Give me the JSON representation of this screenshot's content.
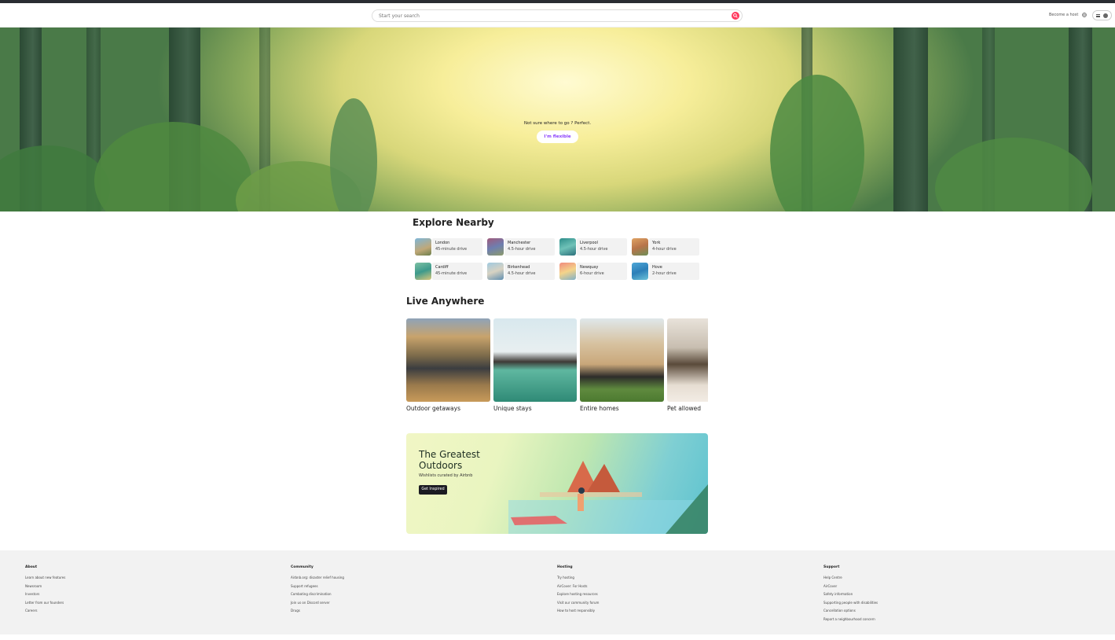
{
  "header": {
    "search_placeholder": "Start your search",
    "become_host": "Become a host"
  },
  "hero": {
    "tagline": "Not sure where to go ? Perfect.",
    "flexible_button": "I'm flexible"
  },
  "explore_nearby": {
    "title": "Explore Nearby",
    "items": [
      {
        "city": "London",
        "drive": "45-minute drive"
      },
      {
        "city": "Manchester",
        "drive": "4.5-hour drive"
      },
      {
        "city": "Liverpool",
        "drive": "4.5-hour drive"
      },
      {
        "city": "York",
        "drive": "4-hour drive"
      },
      {
        "city": "Cardiff",
        "drive": "45-minute drive"
      },
      {
        "city": "Birkenhead",
        "drive": "4.5-hour drive"
      },
      {
        "city": "Newquay",
        "drive": "6-hour drive"
      },
      {
        "city": "Hove",
        "drive": "2-hour drive"
      }
    ]
  },
  "live_anywhere": {
    "title": "Live Anywhere",
    "cards": [
      {
        "label": "Outdoor getaways"
      },
      {
        "label": "Unique stays"
      },
      {
        "label": "Entire homes"
      },
      {
        "label": "Pet allowed"
      }
    ]
  },
  "promo": {
    "title": "The Greatest Outdoors",
    "subtitle": "Wishlists curated by Airbnb",
    "button": "Get Inspired"
  },
  "footer": {
    "columns": [
      {
        "heading": "About",
        "links": [
          "Learn about new features",
          "Newsroom",
          "Investors",
          "Letter from our founders",
          "Careers"
        ]
      },
      {
        "heading": "Community",
        "links": [
          "Airbnb.org: disaster relief housing",
          "Support refugees",
          "Combating discrimination",
          "Join us on Discord server",
          "Drugs"
        ]
      },
      {
        "heading": "Hosting",
        "links": [
          "Try hosting",
          "AirCover: For Hosts",
          "Explore hosting resources",
          "Visit our community forum",
          "How to host responsibly"
        ]
      },
      {
        "heading": "Support",
        "links": [
          "Help Centre",
          "AirCover",
          "Safety information",
          "Supporting people with disabilities",
          "Cancellation options",
          "Report a neighbourhood concern"
        ]
      }
    ]
  },
  "colors": {
    "brand": "#ff385c",
    "flexible_text": "#8a3ffc",
    "footer_bg": "#f2f2f2"
  },
  "icons": [
    "search-icon",
    "globe-icon",
    "menu-icon",
    "user-avatar-icon"
  ]
}
